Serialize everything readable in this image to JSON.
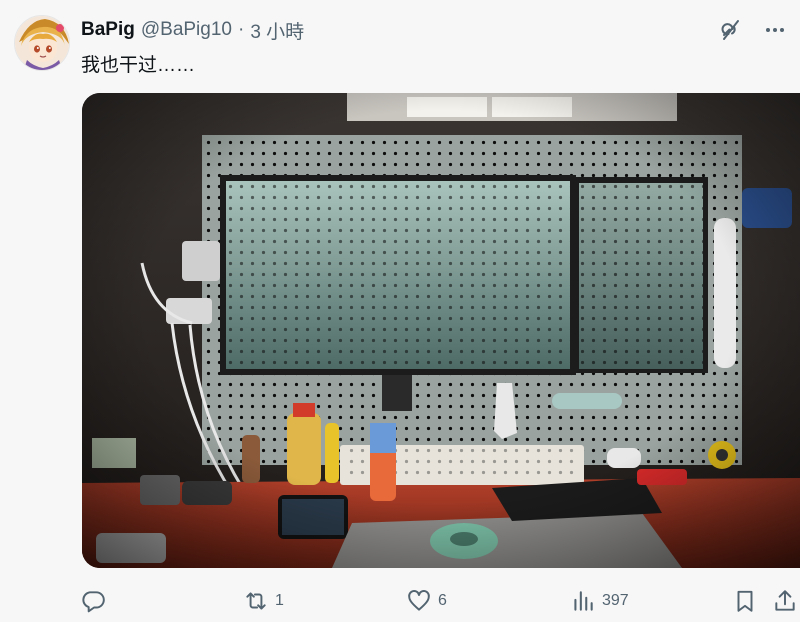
{
  "tweet": {
    "author": {
      "display_name": "BaPig",
      "handle": "@BaPig10",
      "separator": "·",
      "timestamp": "3 小時",
      "avatar_icon": "anime-character-avatar"
    },
    "text": "我也干过……",
    "media": {
      "kind": "photo",
      "description_icon": "desk-setup-photo"
    },
    "actions": {
      "reply": {
        "icon": "reply-icon",
        "count": ""
      },
      "retweet": {
        "icon": "retweet-icon",
        "count": "1"
      },
      "like": {
        "icon": "heart-icon",
        "count": "6"
      },
      "views": {
        "icon": "views-icon",
        "count": "397"
      },
      "bookmark": {
        "icon": "bookmark-icon"
      },
      "share": {
        "icon": "share-icon"
      }
    },
    "header_icons": [
      "grok-icon",
      "more-icon"
    ]
  },
  "colors": {
    "text_primary": "#0f1419",
    "text_secondary": "#536471",
    "background": "#f7f7f7"
  }
}
